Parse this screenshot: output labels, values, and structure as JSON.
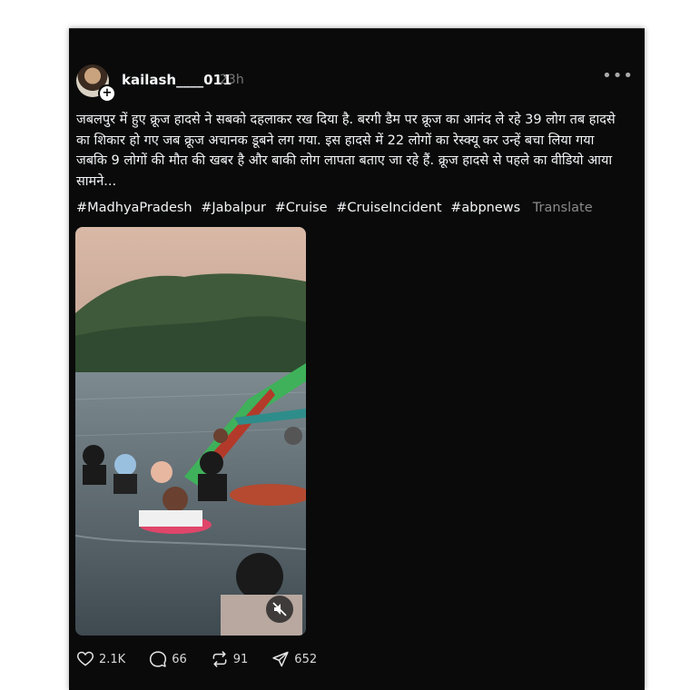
{
  "post": {
    "username": "kailash____011",
    "time": "23h",
    "more_label": "•••",
    "avatar_plus": "+",
    "text": "जबलपुर में हुए क्रूज हादसे ने सबको दहलाकर रख दिया है. बरगी डैम पर क्रूज का आनंद ले रहे 39 लोग तब हादसे का शिकार हो गए जब क्रूज अचानक डूबने लग गया. इस हादसे में 22 लोगों का रेस्क्यू कर उन्हें बचा लिया गया जबकि 9 लोगों की मौत की खबर है और बाकी लोग लापता बताए जा रहे हैं. क्रूज हादसे से पहले का वीडियो आया सामने...",
    "hashtags": [
      "#MadhyaPradesh",
      "#Jabalpur",
      "#Cruise",
      "#CruiseIncident",
      "#abpnews"
    ],
    "translate_label": "Translate"
  },
  "actions": {
    "likes": "2.1K",
    "comments": "66",
    "reposts": "91",
    "shares": "652"
  },
  "icons": {
    "like": "heart-icon",
    "comment": "comment-bubble-icon",
    "repost": "repost-icon",
    "share": "send-icon",
    "mute": "speaker-muted-icon",
    "more": "more-dots-icon"
  },
  "colors": {
    "background": "#0a0a0a",
    "text": "#f3f5f7",
    "muted": "#777777"
  }
}
